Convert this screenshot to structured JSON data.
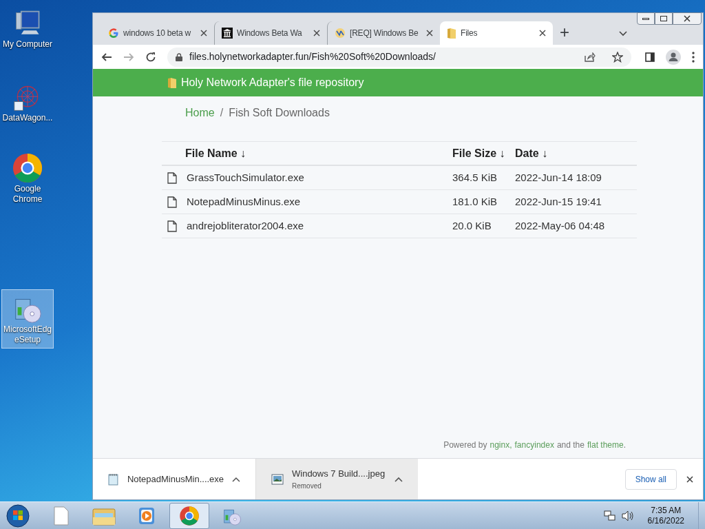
{
  "desktop_icons": [
    {
      "label": "My Computer",
      "kind": "computer",
      "selected": false
    },
    {
      "label": "DataWagon...",
      "kind": "network",
      "selected": false
    },
    {
      "label": "Google Chrome",
      "kind": "chrome",
      "selected": false
    },
    {
      "label": "MicrosoftEdgeSetup",
      "kind": "installer",
      "selected": true
    }
  ],
  "browser": {
    "tabs": [
      {
        "title": "windows 10 beta w",
        "kind": "google",
        "selected": false
      },
      {
        "title": "Windows Beta Wa",
        "kind": "museum",
        "selected": false
      },
      {
        "title": "[REQ] Windows Be",
        "kind": "forum",
        "selected": false
      },
      {
        "title": "Files",
        "kind": "folder",
        "selected": true
      }
    ],
    "new_tab": "+",
    "address": "files.holynetworkadapter.fun/Fish%20Soft%20Downloads/",
    "page": {
      "banner": "Holy Network Adapter's file repository",
      "breadcrumb": [
        "Home",
        "Fish Soft Downloads"
      ],
      "breadcrumb_separator": "/",
      "columns": [
        {
          "label": "File Name",
          "sort": "↓"
        },
        {
          "label": "File Size",
          "sort": "↓"
        },
        {
          "label": "Date",
          "sort": "↓"
        }
      ],
      "rows": [
        {
          "name": "GrassTouchSimulator.exe",
          "size": "364.5 KiB",
          "date": "2022-Jun-14 18:09"
        },
        {
          "name": "NotepadMinusMinus.exe",
          "size": "181.0 KiB",
          "date": "2022-Jun-15 19:41"
        },
        {
          "name": "andrejobliterator2004.exe",
          "size": "20.0 KiB",
          "date": "2022-May-06 04:48"
        }
      ],
      "footer": [
        {
          "text": "Powered by",
          "link": false
        },
        {
          "text": "nginx,",
          "link": true
        },
        {
          "text": "fancyindex",
          "link": true
        },
        {
          "text": "and the",
          "link": false
        },
        {
          "text": "flat theme",
          "link": true
        },
        {
          "text": "."
        }
      ]
    },
    "downloads": [
      {
        "name": "NotepadMinusMin....exe",
        "kind": "notepad",
        "selected": false
      },
      {
        "name": "Windows 7 Build....jpeg",
        "status": "Removed",
        "kind": "image",
        "selected": true
      }
    ],
    "show_all": "Show all"
  },
  "taskbar": {
    "items": [
      {
        "kind": "document",
        "selected": false
      },
      {
        "kind": "explorer",
        "selected": false
      },
      {
        "kind": "media",
        "selected": false
      },
      {
        "kind": "chrome",
        "selected": true
      },
      {
        "kind": "installer",
        "selected": false
      }
    ],
    "time": "7:35 AM",
    "date": "6/16/2022"
  }
}
